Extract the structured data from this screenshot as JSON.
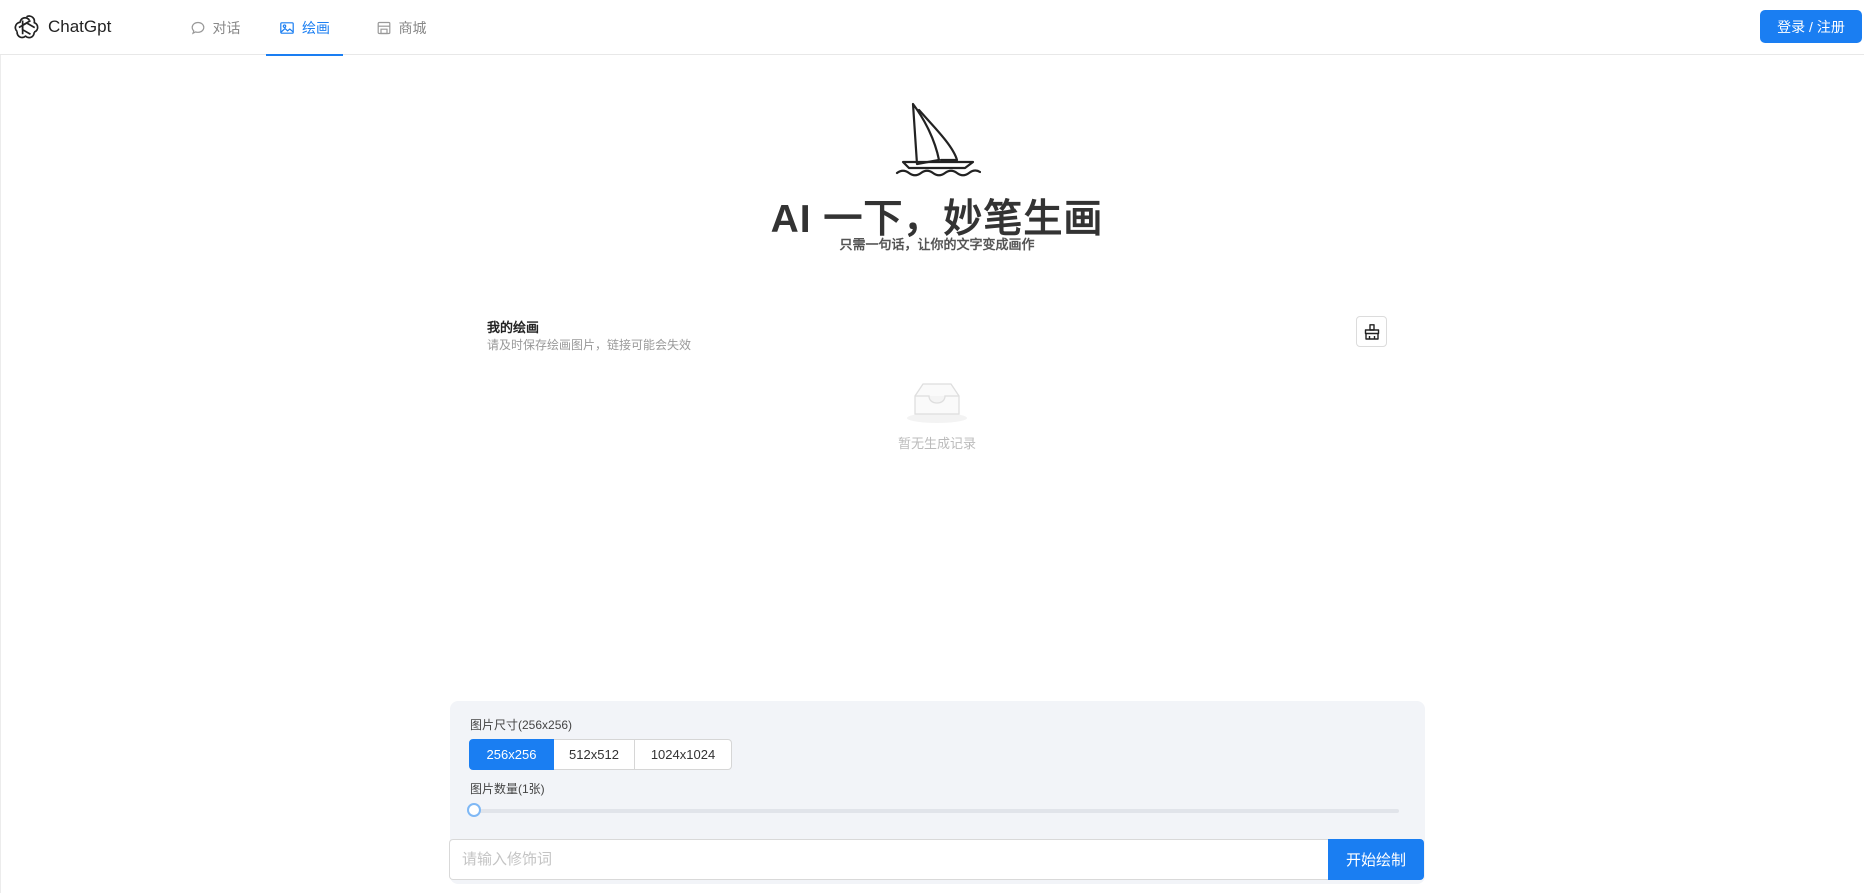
{
  "header": {
    "brand": "ChatGpt",
    "nav": [
      {
        "label": "对话",
        "icon": "chat-bubble-icon"
      },
      {
        "label": "绘画",
        "icon": "image-icon",
        "active": true
      },
      {
        "label": "商城",
        "icon": "store-icon"
      }
    ],
    "login_label": "登录 / 注册"
  },
  "hero": {
    "title": "AI 一下，妙笔生画",
    "subtitle": "只需一句话，让你的文字变成画作"
  },
  "drawings": {
    "title": "我的绘画",
    "subtitle": "请及时保存绘画图片，链接可能会失效",
    "empty_text": "暂无生成记录",
    "clear_icon": "broom-icon"
  },
  "settings": {
    "size_label": "图片尺寸(256x256)",
    "size_options": [
      "256x256",
      "512x512",
      "1024x1024"
    ],
    "selected_size": "256x256",
    "count_label": "图片数量(1张)",
    "count_value": 1,
    "prompt_placeholder": "请输入修饰词",
    "start_label": "开始绘制"
  },
  "colors": {
    "accent": "#1a7ef2",
    "panel_bg": "#f2f4f8"
  }
}
